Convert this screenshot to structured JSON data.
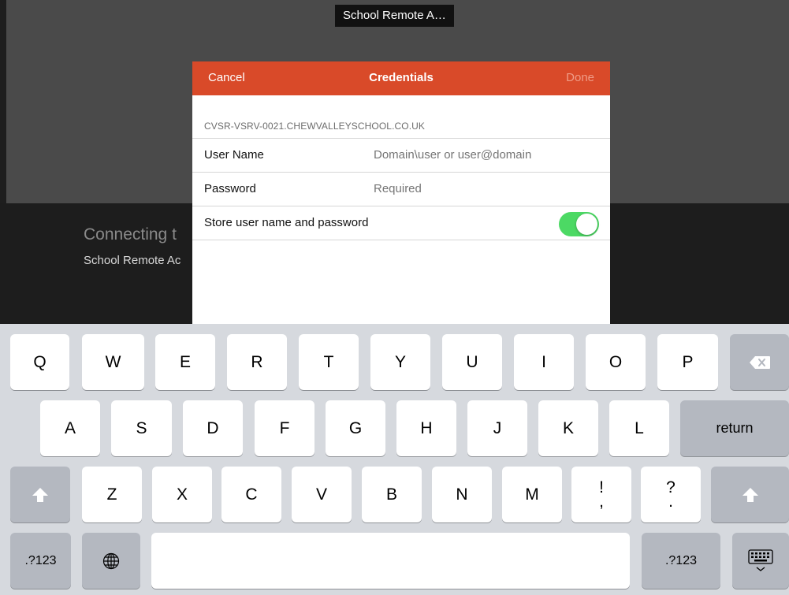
{
  "window_title": "School Remote A…",
  "background": {
    "connecting_text": "Connecting t",
    "connecting_subtext": "School Remote Ac"
  },
  "dialog": {
    "cancel_label": "Cancel",
    "title": "Credentials",
    "done_label": "Done",
    "server": "CVSR-VSRV-0021.CHEWVALLEYSCHOOL.CO.UK",
    "username_label": "User Name",
    "username_placeholder": "Domain\\user or user@domain",
    "password_label": "Password",
    "password_placeholder": "Required",
    "store_label": "Store user name and password",
    "store_enabled": true
  },
  "keyboard": {
    "row1": [
      "Q",
      "W",
      "E",
      "R",
      "T",
      "Y",
      "U",
      "I",
      "O",
      "P"
    ],
    "row2": [
      "A",
      "S",
      "D",
      "F",
      "G",
      "H",
      "J",
      "K",
      "L"
    ],
    "row3": [
      "Z",
      "X",
      "C",
      "V",
      "B",
      "N",
      "M"
    ],
    "punct1_top": "!",
    "punct1_bottom": ",",
    "punct2_top": "?",
    "punct2_bottom": ".",
    "return_label": "return",
    "numbers_label": ".?123",
    "icons": [
      "backspace-icon",
      "shift-icon",
      "globe-icon",
      "keyboard-dismiss-icon"
    ],
    "colors": {
      "letter_key": "#ffffff",
      "function_key": "#b4b8c0",
      "toggle_on": "#4cd964",
      "nav_bar": "#d94a29"
    }
  }
}
